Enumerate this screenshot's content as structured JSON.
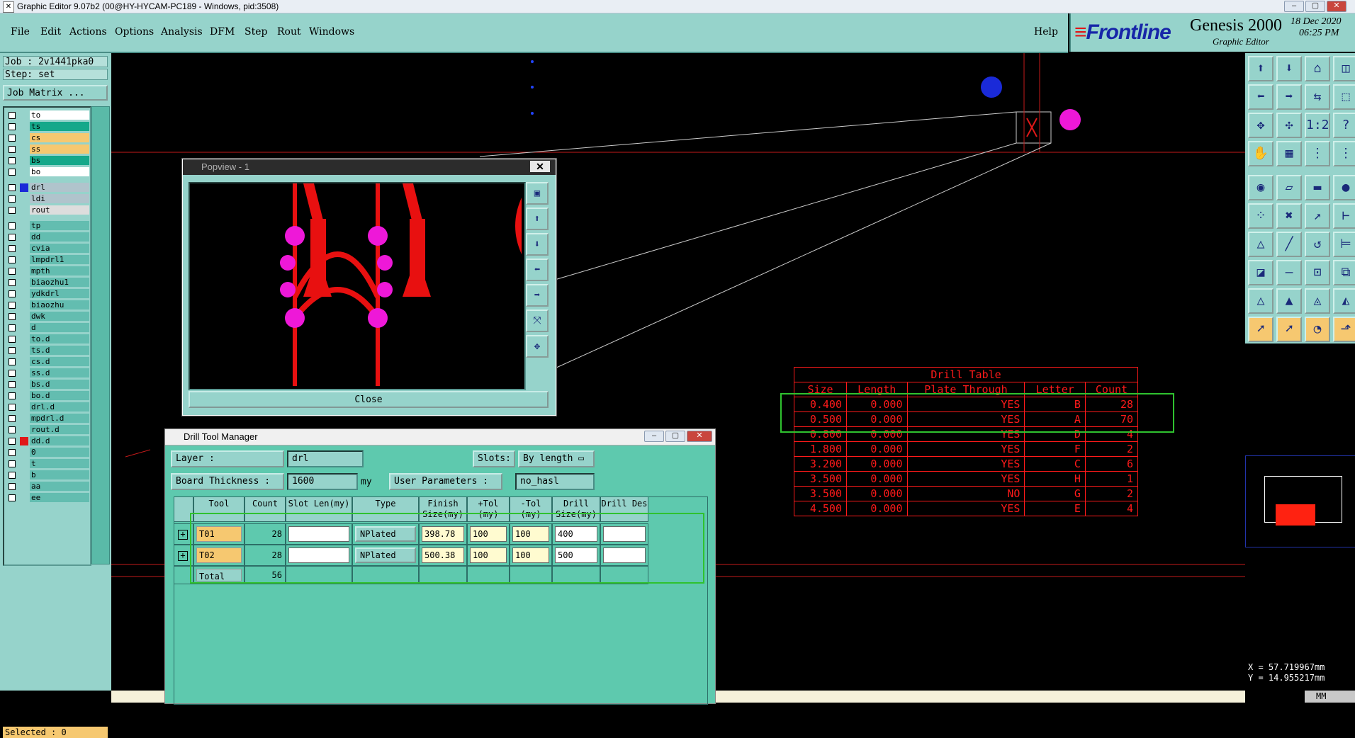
{
  "window": {
    "title": "Graphic Editor 9.07b2 (00@HY-HYCAM-PC189 - Windows, pid:3508)",
    "controls": [
      "–",
      "▢",
      "✕"
    ]
  },
  "menu": [
    "File",
    "Edit",
    "Actions",
    "Options",
    "Analysis",
    "DFM",
    "Step",
    "Rout",
    "Windows"
  ],
  "help_label": "Help",
  "brand": {
    "logo": "Frontline",
    "product": "Genesis 2000",
    "subtitle": "Graphic Editor",
    "date": "18 Dec 2020",
    "time": "06:25 PM"
  },
  "job": {
    "job_line": "Job : 2v1441pka0",
    "step_line": "Step: set",
    "matrix_button": "Job Matrix ..."
  },
  "layers": [
    {
      "name": "to",
      "color": "#ffffff"
    },
    {
      "name": "ts",
      "color": "#16a88a"
    },
    {
      "name": "cs",
      "color": "#f6c870"
    },
    {
      "name": "ss",
      "color": "#f6c870"
    },
    {
      "name": "bs",
      "color": "#16a88a"
    },
    {
      "name": "bo",
      "color": "#ffffff"
    },
    {
      "name": "drl",
      "color": "#b0c4cc",
      "swatch": "#1a2ad8"
    },
    {
      "name": "ldi",
      "color": "#b0c4cc"
    },
    {
      "name": "rout",
      "color": "#dddddd"
    },
    {
      "name": "tp"
    },
    {
      "name": "dd"
    },
    {
      "name": "cvia"
    },
    {
      "name": "lmpdrl1"
    },
    {
      "name": "mpth"
    },
    {
      "name": "biaozhu1"
    },
    {
      "name": "ydkdrl"
    },
    {
      "name": "biaozhu"
    },
    {
      "name": "dwk"
    },
    {
      "name": "d"
    },
    {
      "name": "to.d"
    },
    {
      "name": "ts.d"
    },
    {
      "name": "cs.d"
    },
    {
      "name": "ss.d"
    },
    {
      "name": "bs.d"
    },
    {
      "name": "bo.d"
    },
    {
      "name": "drl.d"
    },
    {
      "name": "mpdrl.d"
    },
    {
      "name": "rout.d"
    },
    {
      "name": "dd.d",
      "swatch": "#e01818"
    },
    {
      "name": "0"
    },
    {
      "name": "t"
    },
    {
      "name": "b"
    },
    {
      "name": "aa"
    },
    {
      "name": "ee"
    }
  ],
  "selected_status": "Selected : 0",
  "coords": {
    "x": "X = 57.719967mm",
    "y": "Y = 14.955217mm"
  },
  "popview": {
    "title": "Popview - 1",
    "close_label": "Close"
  },
  "drill_tool_manager": {
    "title": "Drill Tool Manager",
    "layer_label": "Layer :",
    "layer_value": "drl",
    "slots_label": "Slots:",
    "slots_value": "By length",
    "board_thickness_label": "Board Thickness :",
    "board_thickness_value": "1600",
    "thickness_unit": "my",
    "user_params_label": "User Parameters :",
    "user_params_value": "no_hasl",
    "columns": [
      "Tool",
      "Count",
      "Slot Len(my)",
      "Type",
      "Finish Size(my)",
      "+Tol (my)",
      "-Tol (my)",
      "Drill Size(my)",
      "Drill Des"
    ],
    "rows": [
      {
        "tool": "T01",
        "count": "28",
        "slot": "",
        "type": "NPlated",
        "finish": "398.78",
        "ptol": "100",
        "mtol": "100",
        "drill": "400",
        "des": ""
      },
      {
        "tool": "T02",
        "count": "28",
        "slot": "",
        "type": "NPlated",
        "finish": "500.38",
        "ptol": "100",
        "mtol": "100",
        "drill": "500",
        "des": ""
      }
    ],
    "total_label": "Total",
    "total_count": "56"
  },
  "drill_table": {
    "title": "Drill Table",
    "headers": [
      "Size",
      "Length",
      "Plate Through",
      "Letter",
      "Count"
    ],
    "rows": [
      [
        "0.400",
        "0.000",
        "YES",
        "B",
        "28"
      ],
      [
        "0.500",
        "0.000",
        "YES",
        "A",
        "70"
      ],
      [
        "0.800",
        "0.000",
        "YES",
        "D",
        "4"
      ],
      [
        "1.800",
        "0.000",
        "YES",
        "F",
        "2"
      ],
      [
        "3.200",
        "0.000",
        "YES",
        "C",
        "6"
      ],
      [
        "3.500",
        "0.000",
        "YES",
        "H",
        "1"
      ],
      [
        "3.500",
        "0.000",
        "NO",
        "G",
        "2"
      ],
      [
        "4.500",
        "0.000",
        "YES",
        "E",
        "4"
      ]
    ]
  },
  "status_right": "MM"
}
